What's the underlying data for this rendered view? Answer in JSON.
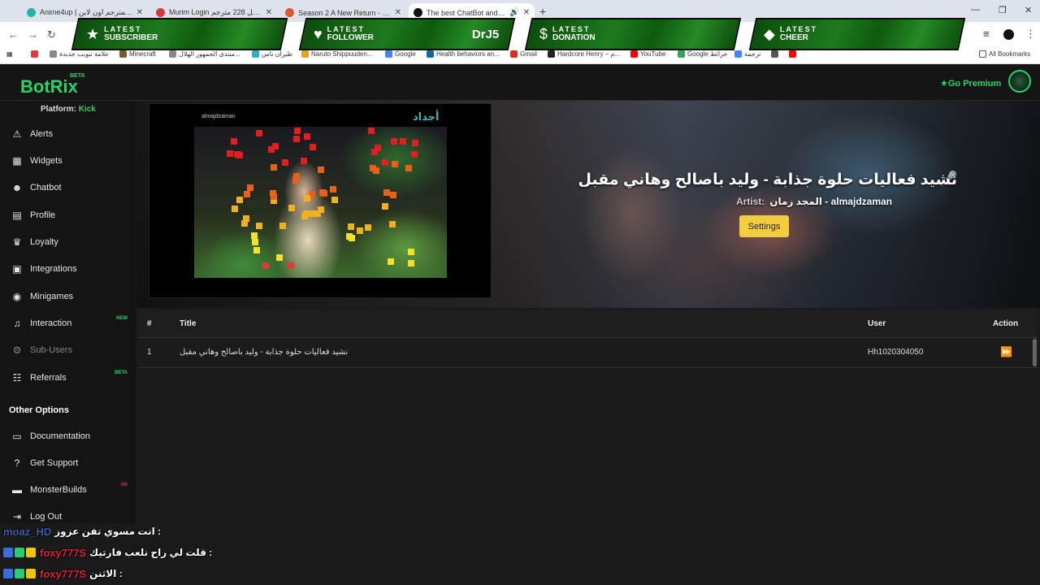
{
  "browser": {
    "tabs": [
      {
        "title": "Anime4up | مشاهدة انمي المترجم اون لاين",
        "favicon_color": "#22b5a5",
        "active": false
      },
      {
        "title": "Murim Login الفصل 228 مترجم",
        "favicon_color": "#d23b3b",
        "active": false
      },
      {
        "title": "Season 2 A New Return - Watch",
        "favicon_color": "#e0552b",
        "active": false
      },
      {
        "title": "The best ChatBot and Widgets",
        "favicon_color": "#111111",
        "active": true
      }
    ],
    "new_tab_icon": "+",
    "window_controls": [
      "—",
      "❐",
      "✕"
    ],
    "bookmarks": [
      {
        "label": "علامة تبويب جديدة",
        "icon_color": "#e53935"
      },
      {
        "label": "Minecraft",
        "icon_color": "#7a5a2a"
      },
      {
        "label": "منتدى الجمهور الهلال...",
        "icon_color": "#888888"
      },
      {
        "label": "طيران ناس",
        "icon_color": "#2ab0c8"
      },
      {
        "label": "Naruto Shippuuden...",
        "icon_color": "#e8a020"
      },
      {
        "label": "Google",
        "icon_color": "#4285f4"
      },
      {
        "label": "Health behaviors an...",
        "icon_color": "#0f6aa8"
      },
      {
        "label": "Gmail",
        "icon_color": "#d93025"
      },
      {
        "label": "Hardcore Henry – م...",
        "icon_color": "#222222"
      },
      {
        "label": "YouTube",
        "icon_color": "#ff0000"
      },
      {
        "label": "Google خرائط",
        "icon_color": "#34a853"
      },
      {
        "label": "ترجمة",
        "icon_color": "#4285f4"
      }
    ],
    "all_bookmarks": "All Bookmarks"
  },
  "overlay": {
    "banners": [
      {
        "top_label": "LATEST",
        "bottom_label": "SUBSCRIBER",
        "icon": "★",
        "value": ""
      },
      {
        "top_label": "LATEST",
        "bottom_label": "FOLLOWER",
        "icon": "♥",
        "value": "DrJ5"
      },
      {
        "top_label": "LATEST",
        "bottom_label": "DONATION",
        "icon": "$",
        "value": ""
      },
      {
        "top_label": "LATEST",
        "bottom_label": "CHEER",
        "icon": "◆",
        "value": ""
      }
    ],
    "chat": [
      {
        "user": "moaz_HD",
        "message": "انت مسوي تفن عزوز :",
        "badges": []
      },
      {
        "user": "foxy777S",
        "message": "قلت لي راح نلعب فارتيك :",
        "badges": [
          "#3a6be0",
          "#2ecc71",
          "#f1c40f"
        ]
      },
      {
        "user": "foxy777S",
        "message": "الاثنن :",
        "badges": [
          "#3a6be0",
          "#2ecc71",
          "#f1c40f"
        ]
      }
    ]
  },
  "app": {
    "logo": "BotRix",
    "beta_tag": "BETA",
    "premium": "Go Premium",
    "platform_label": "Platform:",
    "platform_value": "Kick",
    "nav": [
      {
        "label": "Alerts",
        "icon": "⚠",
        "tag": ""
      },
      {
        "label": "Widgets",
        "icon": "▦",
        "tag": ""
      },
      {
        "label": "Chatbot",
        "icon": "☻",
        "tag": ""
      },
      {
        "label": "Profile",
        "icon": "▤",
        "tag": ""
      },
      {
        "label": "Loyalty",
        "icon": "🏆",
        "tag": ""
      },
      {
        "label": "Integrations",
        "icon": "▣",
        "tag": ""
      },
      {
        "label": "Minigames",
        "icon": "🎮",
        "tag": ""
      },
      {
        "label": "Interaction",
        "icon": "♫",
        "tag": "NEW",
        "tag_color": "#2ad36a"
      },
      {
        "label": "Sub-Users",
        "icon": "⚙",
        "tag": "",
        "dim": true
      },
      {
        "label": "Referrals",
        "icon": "👥",
        "tag": "BETA",
        "tag_color": "#2ad36a"
      }
    ],
    "other_options": "Other Options",
    "other_nav": [
      {
        "label": "Documentation",
        "icon": "▭",
        "tag": ""
      },
      {
        "label": "Get Support",
        "icon": "?",
        "tag": ""
      },
      {
        "label": "MonsterBuilds",
        "icon": "▬",
        "tag": "AD",
        "tag_color": "#d33"
      },
      {
        "label": "Log Out",
        "icon": "⇥",
        "tag": ""
      }
    ],
    "now_playing": {
      "title": "نشيد فعاليات حلوة جذابة - وليد باصالح وهاني مقبل",
      "artist_label": "Artist:",
      "artist": "المجد زمان - almajdzaman",
      "settings": "Settings",
      "video_handle": "almajdzaman",
      "video_logo": "أجداد"
    },
    "table": {
      "headers": [
        "#",
        "Title",
        "User",
        "Action"
      ],
      "rows": [
        {
          "num": "1",
          "title": "نشيد فعاليات حلوة جذابة - وليد باصالح وهاني مقبل",
          "user": "Hh1020304050"
        }
      ]
    }
  }
}
